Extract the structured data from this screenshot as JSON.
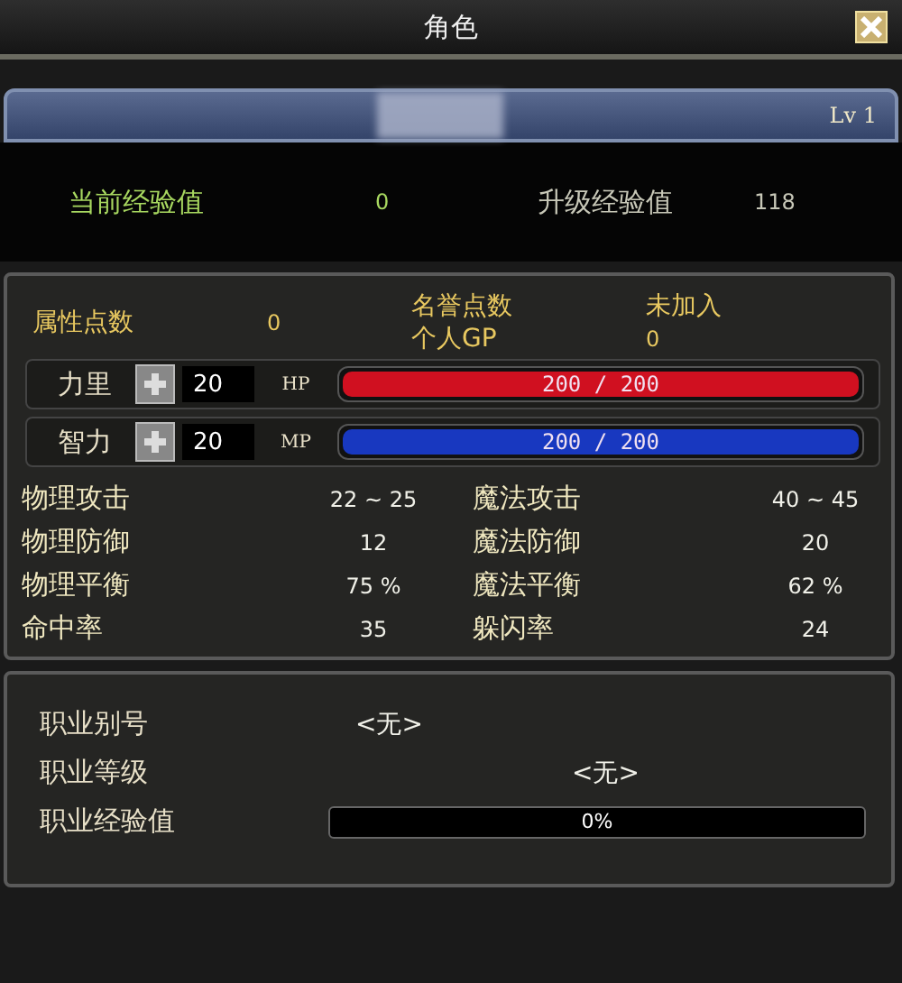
{
  "window": {
    "title": "角色"
  },
  "name_bar": {
    "level": "Lv 1"
  },
  "experience": {
    "current_label": "当前经验值",
    "current_value": "0",
    "next_label": "升级经验值",
    "next_value": "118"
  },
  "points": {
    "label": "属性点数",
    "value": "0",
    "honor_label": "名誉点数",
    "honor_value": "未加入",
    "gp_label": "个人GP",
    "gp_value": "0"
  },
  "stats": [
    {
      "label": "力里",
      "value": "20",
      "bar_label": "HP",
      "reading": "200 / 200",
      "level": 1,
      "color": "#d01020"
    },
    {
      "label": "智力",
      "value": "20",
      "bar_label": "MP",
      "reading": "200 / 200",
      "level": 1,
      "color": "#1838c0"
    }
  ],
  "attributes": [
    {
      "label": "物理攻击",
      "value": "22 ~ 25"
    },
    {
      "label": "魔法攻击",
      "value": "40 ~ 45"
    },
    {
      "label": "物理防御",
      "value": "12"
    },
    {
      "label": "魔法防御",
      "value": "20"
    },
    {
      "label": "物理平衡",
      "value": "75 %"
    },
    {
      "label": "魔法平衡",
      "value": "62 %"
    },
    {
      "label": "命中率",
      "value": "35"
    },
    {
      "label": "躲闪率",
      "value": "24"
    }
  ],
  "job": {
    "title_label": "职业别号",
    "title_value": "<无>",
    "level_label": "职业等级",
    "level_value": "<无>",
    "exp_bar": {
      "label": "职业经验值",
      "reading": "0%",
      "level": 0
    }
  }
}
